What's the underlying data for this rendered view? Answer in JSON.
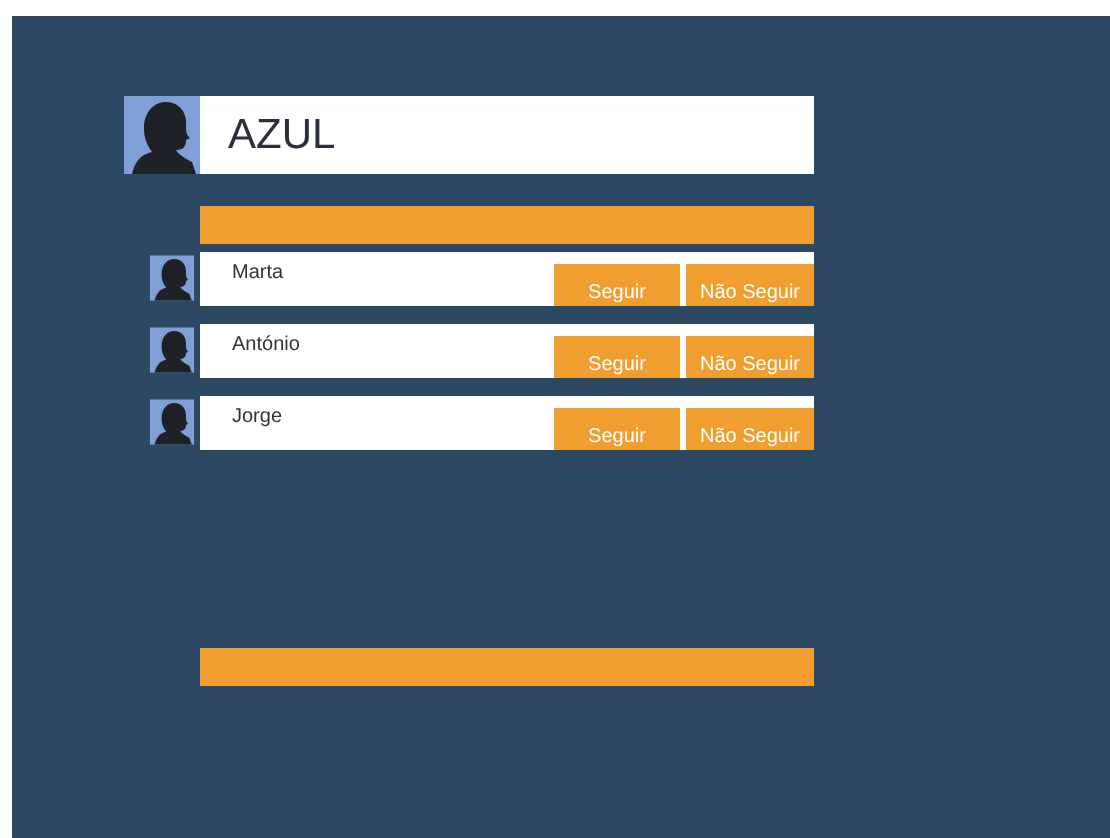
{
  "profile": {
    "name": "AZUL"
  },
  "people": [
    {
      "name": "Marta",
      "buttons": [
        "Seguir",
        "Não Seguir"
      ]
    },
    {
      "name": "António",
      "buttons": [
        "Seguir",
        "Não Seguir"
      ]
    },
    {
      "name": "Jorge",
      "buttons": [
        "Seguir",
        "Não Seguir"
      ]
    }
  ]
}
